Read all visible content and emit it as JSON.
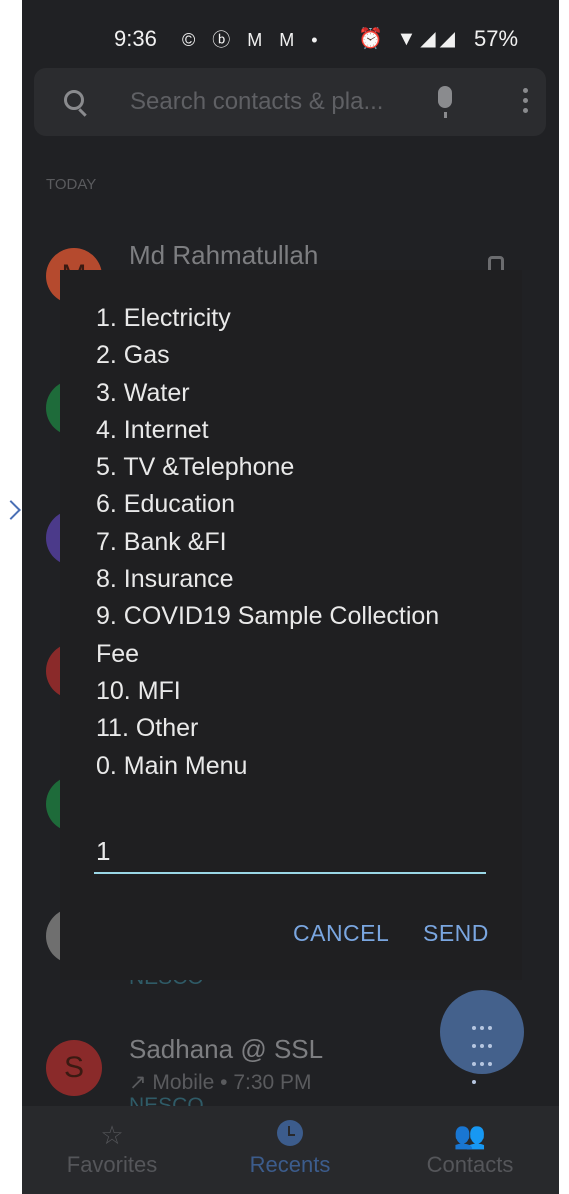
{
  "status_bar": {
    "time": "9:36",
    "icons": "© ⓑ M M •",
    "right_icons": "⏰ ▼◢◢",
    "battery": "57%"
  },
  "search": {
    "placeholder": "Search contacts & pla..."
  },
  "section_label": "TODAY",
  "contacts": [
    {
      "name": "Md Rahmatullah",
      "initial": "M",
      "color": "#b54a2e"
    },
    {
      "name": "",
      "initial": "",
      "color": "#1e6b3a"
    },
    {
      "name": "",
      "initial": "",
      "color": "#4b3a8a"
    },
    {
      "name": "",
      "initial": "",
      "color": "#8a2a2a"
    },
    {
      "name": "",
      "initial": "",
      "color": "#1e6b3a"
    },
    {
      "name": "",
      "initial": "",
      "color": "#6f6f6f",
      "sub2": "NESCO"
    },
    {
      "name": "Sadhana @ SSL",
      "initial": "S",
      "color": "#8a2a2a",
      "sub": "↗ Mobile • 7:30 PM",
      "sub2": "NESCO"
    }
  ],
  "dialog": {
    "menu_items": [
      "1. Electricity",
      "2. Gas",
      "3. Water",
      "4. Internet",
      "5. TV &Telephone",
      "6. Education",
      "7. Bank &FI",
      "8. Insurance",
      "9. COVID19 Sample Collection",
      "Fee",
      "10. MFI",
      "11. Other",
      "0. Main Menu"
    ],
    "input_value": "1",
    "cancel_label": "CANCEL",
    "send_label": "SEND"
  },
  "bottom_nav": {
    "favorites": "Favorites",
    "recents": "Recents",
    "contacts": "Contacts"
  },
  "colors": {
    "accent": "#7aa6e0",
    "input_underline": "#9ad7e6",
    "dialog_bg": "#1f1f21"
  }
}
